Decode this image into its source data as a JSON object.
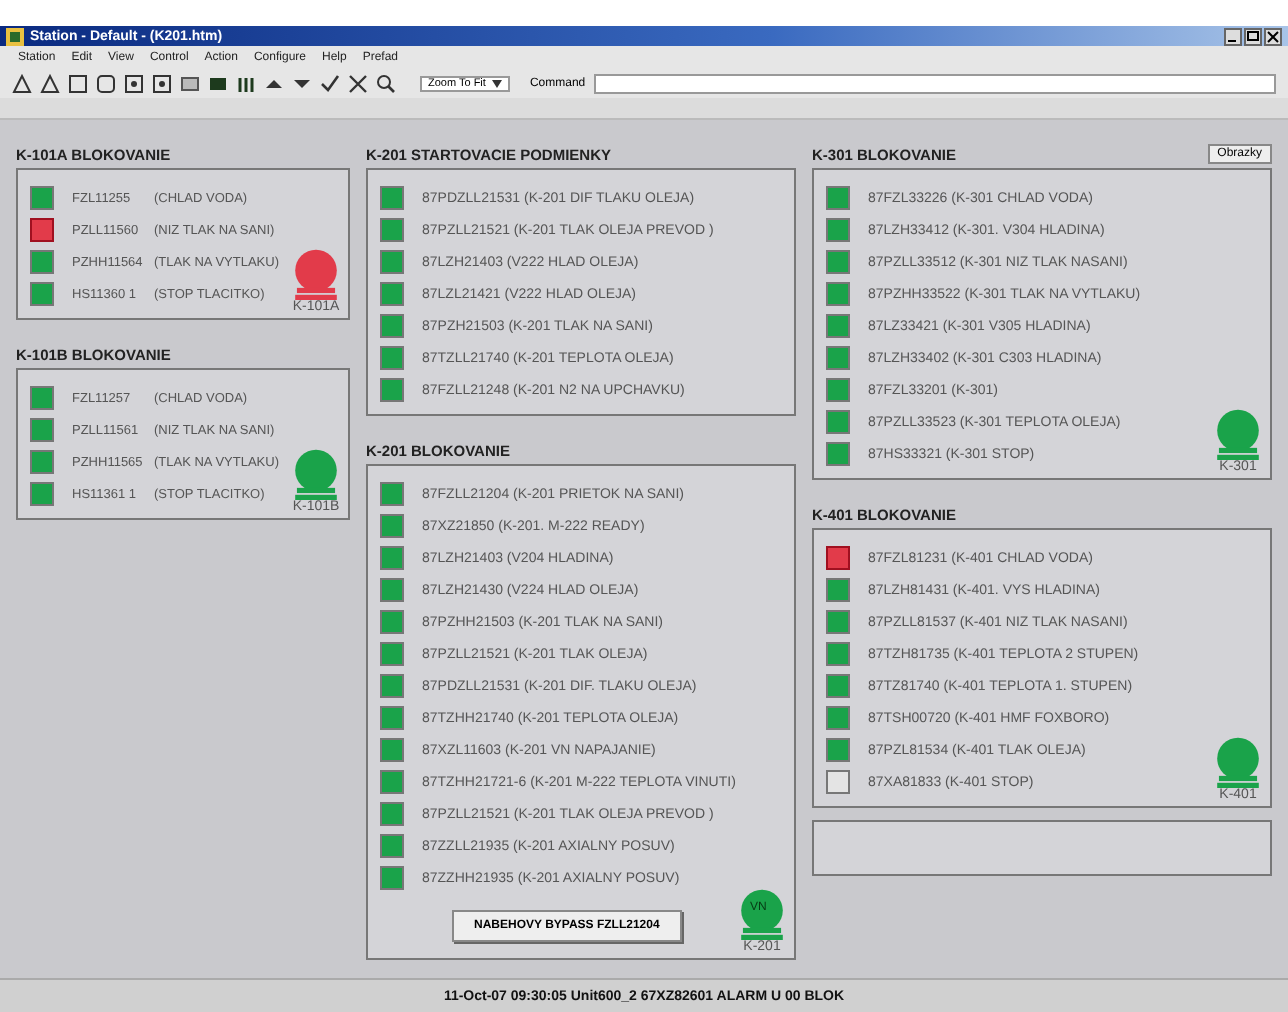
{
  "window": {
    "title": "Station - Default - (K201.htm)"
  },
  "menu": [
    "Station",
    "Edit",
    "View",
    "Control",
    "Action",
    "Configure",
    "Help",
    "Prefad"
  ],
  "toolbar": {
    "zoom": "Zoom To Fit",
    "command_label": "Command"
  },
  "top_button": "Obrazky",
  "columns": [
    {
      "sections": [
        {
          "title": "K-101A BLOKOVANIE",
          "rows": [
            {
              "tag": "FZL11255",
              "desc": "(CHLAD VODA)",
              "on": true,
              "alarm": false
            },
            {
              "tag": "PZLL11560",
              "desc": "(NIZ TLAK NA SANI)",
              "on": true,
              "alarm": true
            },
            {
              "tag": "PZHH11564",
              "desc": "(TLAK NA VYTLAKU)",
              "on": true,
              "alarm": false
            },
            {
              "tag": "HS11360  1",
              "desc": "(STOP TLACITKO)",
              "on": true,
              "alarm": false
            }
          ],
          "unit": {
            "label": "K-101A",
            "alarm": true
          }
        },
        {
          "title": "K-101B BLOKOVANIE",
          "rows": [
            {
              "tag": "FZL11257",
              "desc": "(CHLAD VODA)",
              "on": true,
              "alarm": false
            },
            {
              "tag": "PZLL11561",
              "desc": "(NIZ TLAK NA SANI)",
              "on": true,
              "alarm": false
            },
            {
              "tag": "PZHH11565",
              "desc": "(TLAK NA VYTLAKU)",
              "on": true,
              "alarm": false
            },
            {
              "tag": "HS11361  1",
              "desc": "(STOP TLACITKO)",
              "on": true,
              "alarm": false
            }
          ],
          "unit": {
            "label": "K-101B",
            "alarm": false
          }
        }
      ]
    },
    {
      "sections": [
        {
          "title": "K-201 STARTOVACIE PODMIENKY",
          "rows": [
            {
              "text": "87PDZLL21531 (K-201 DIF TLAKU OLEJA)",
              "on": true,
              "alarm": false
            },
            {
              "text": "87PZLL21521 (K-201 TLAK OLEJA PREVOD )",
              "on": true,
              "alarm": false
            },
            {
              "text": "87LZH21403 (V222 HLAD OLEJA)",
              "on": true,
              "alarm": false
            },
            {
              "text": "87LZL21421 (V222 HLAD OLEJA)",
              "on": true,
              "alarm": false
            },
            {
              "text": "87PZH21503 (K-201 TLAK NA SANI)",
              "on": true,
              "alarm": false
            },
            {
              "text": "87TZLL21740 (K-201 TEPLOTA OLEJA)",
              "on": true,
              "alarm": false
            },
            {
              "text": "87FZLL21248 (K-201 N2 NA UPCHAVKU)",
              "on": true,
              "alarm": false
            }
          ]
        },
        {
          "title": "K-201 BLOKOVANIE",
          "rows": [
            {
              "text": "87FZLL21204 (K-201 PRIETOK NA SANI)",
              "on": true,
              "alarm": false
            },
            {
              "text": "87XZ21850 (K-201. M-222 READY)",
              "on": true,
              "alarm": false
            },
            {
              "text": "87LZH21403 (V204 HLADINA)",
              "on": true,
              "alarm": false
            },
            {
              "text": "87LZH21430 (V224 HLAD OLEJA)",
              "on": true,
              "alarm": false
            },
            {
              "text": "87PZHH21503 (K-201 TLAK NA SANI)",
              "on": true,
              "alarm": false
            },
            {
              "text": "87PZLL21521 (K-201 TLAK OLEJA)",
              "on": true,
              "alarm": false
            },
            {
              "text": "87PDZLL21531 (K-201 DIF. TLAKU OLEJA)",
              "on": true,
              "alarm": false
            },
            {
              "text": "87TZHH21740 (K-201 TEPLOTA OLEJA)",
              "on": true,
              "alarm": false
            },
            {
              "text": "87XZL11603 (K-201 VN NAPAJANIE)",
              "on": true,
              "alarm": false
            },
            {
              "text": "87TZHH21721-6 (K-201 M-222 TEPLOTA VINUTI)",
              "on": true,
              "alarm": false
            },
            {
              "text": "87PZLL21521 (K-201 TLAK OLEJA PREVOD )",
              "on": true,
              "alarm": false
            },
            {
              "text": "87ZZLL21935 (K-201 AXIALNY POSUV)",
              "on": true,
              "alarm": false
            },
            {
              "text": "87ZZHH21935 (K-201 AXIALNY POSUV)",
              "on": true,
              "alarm": false
            }
          ],
          "button": "NABEHOVY BYPASS FZLL21204",
          "unit": {
            "label": "K-201",
            "alarm": false,
            "badge": "VN"
          }
        }
      ]
    },
    {
      "sections": [
        {
          "title": "K-301 BLOKOVANIE",
          "rows": [
            {
              "text": "87FZL33226 (K-301 CHLAD VODA)",
              "on": true,
              "alarm": false
            },
            {
              "text": "87LZH33412 (K-301. V304 HLADINA)",
              "on": true,
              "alarm": false
            },
            {
              "text": "87PZLL33512 (K-301 NIZ TLAK NASANI)",
              "on": true,
              "alarm": false
            },
            {
              "text": "87PZHH33522 (K-301 TLAK NA VYTLAKU)",
              "on": true,
              "alarm": false
            },
            {
              "text": "87LZ33421 (K-301 V305 HLADINA)",
              "on": true,
              "alarm": false
            },
            {
              "text": "87LZH33402 (K-301 C303 HLADINA)",
              "on": true,
              "alarm": false
            },
            {
              "text": "87FZL33201 (K-301)",
              "on": true,
              "alarm": false
            },
            {
              "text": "87PZLL33523 (K-301 TEPLOTA OLEJA)",
              "on": true,
              "alarm": false
            },
            {
              "text": "87HS33321 (K-301 STOP)",
              "on": true,
              "alarm": false
            }
          ],
          "unit": {
            "label": "K-301",
            "alarm": false
          }
        },
        {
          "title": "K-401 BLOKOVANIE",
          "rows": [
            {
              "text": "87FZL81231 (K-401 CHLAD VODA)",
              "on": true,
              "alarm": true
            },
            {
              "text": "87LZH81431 (K-401. VYS HLADINA)",
              "on": true,
              "alarm": false
            },
            {
              "text": "87PZLL81537 (K-401 NIZ TLAK NASANI)",
              "on": true,
              "alarm": false
            },
            {
              "text": "87TZH81735 (K-401 TEPLOTA 2 STUPEN)",
              "on": true,
              "alarm": false
            },
            {
              "text": "87TZ81740 (K-401 TEPLOTA 1. STUPEN)",
              "on": true,
              "alarm": false
            },
            {
              "text": "87TSH00720 (K-401 HMF FOXBORO)",
              "on": true,
              "alarm": false
            },
            {
              "text": "87PZL81534 (K-401 TLAK OLEJA)",
              "on": true,
              "alarm": false
            },
            {
              "text": "87XA81833 (K-401 STOP)",
              "on": false,
              "alarm": false
            }
          ],
          "unit": {
            "label": "K-401",
            "alarm": false
          }
        }
      ]
    }
  ],
  "status_bar": "11-Oct-07 09:30:05 Unit600_2 67XZ82601 ALARM U 00 BLOK"
}
